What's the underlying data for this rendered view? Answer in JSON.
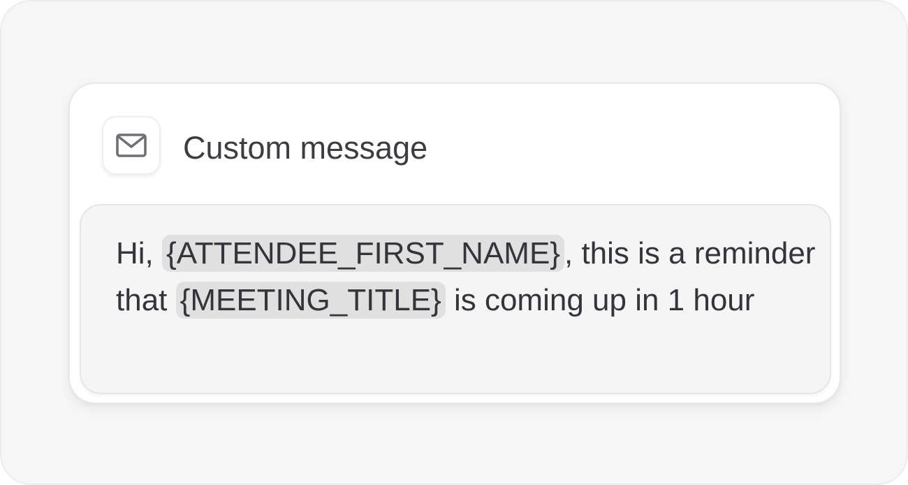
{
  "card": {
    "icon": "mail-icon",
    "title": "Custom message"
  },
  "message": {
    "greeting": "Hi, ",
    "attendee_var": "{ATTENDEE_FIRST_NAME}",
    "text_1": ", this is a reminder that ",
    "meeting_var": "{MEETING_TITLE}",
    "text_2": " is coming up in 1 hour"
  },
  "colors": {
    "background": "#f6f6f6",
    "card": "#ffffff",
    "message_box": "#f5f5f5",
    "variable_chip": "#e0e0e0",
    "text": "#34343a"
  }
}
